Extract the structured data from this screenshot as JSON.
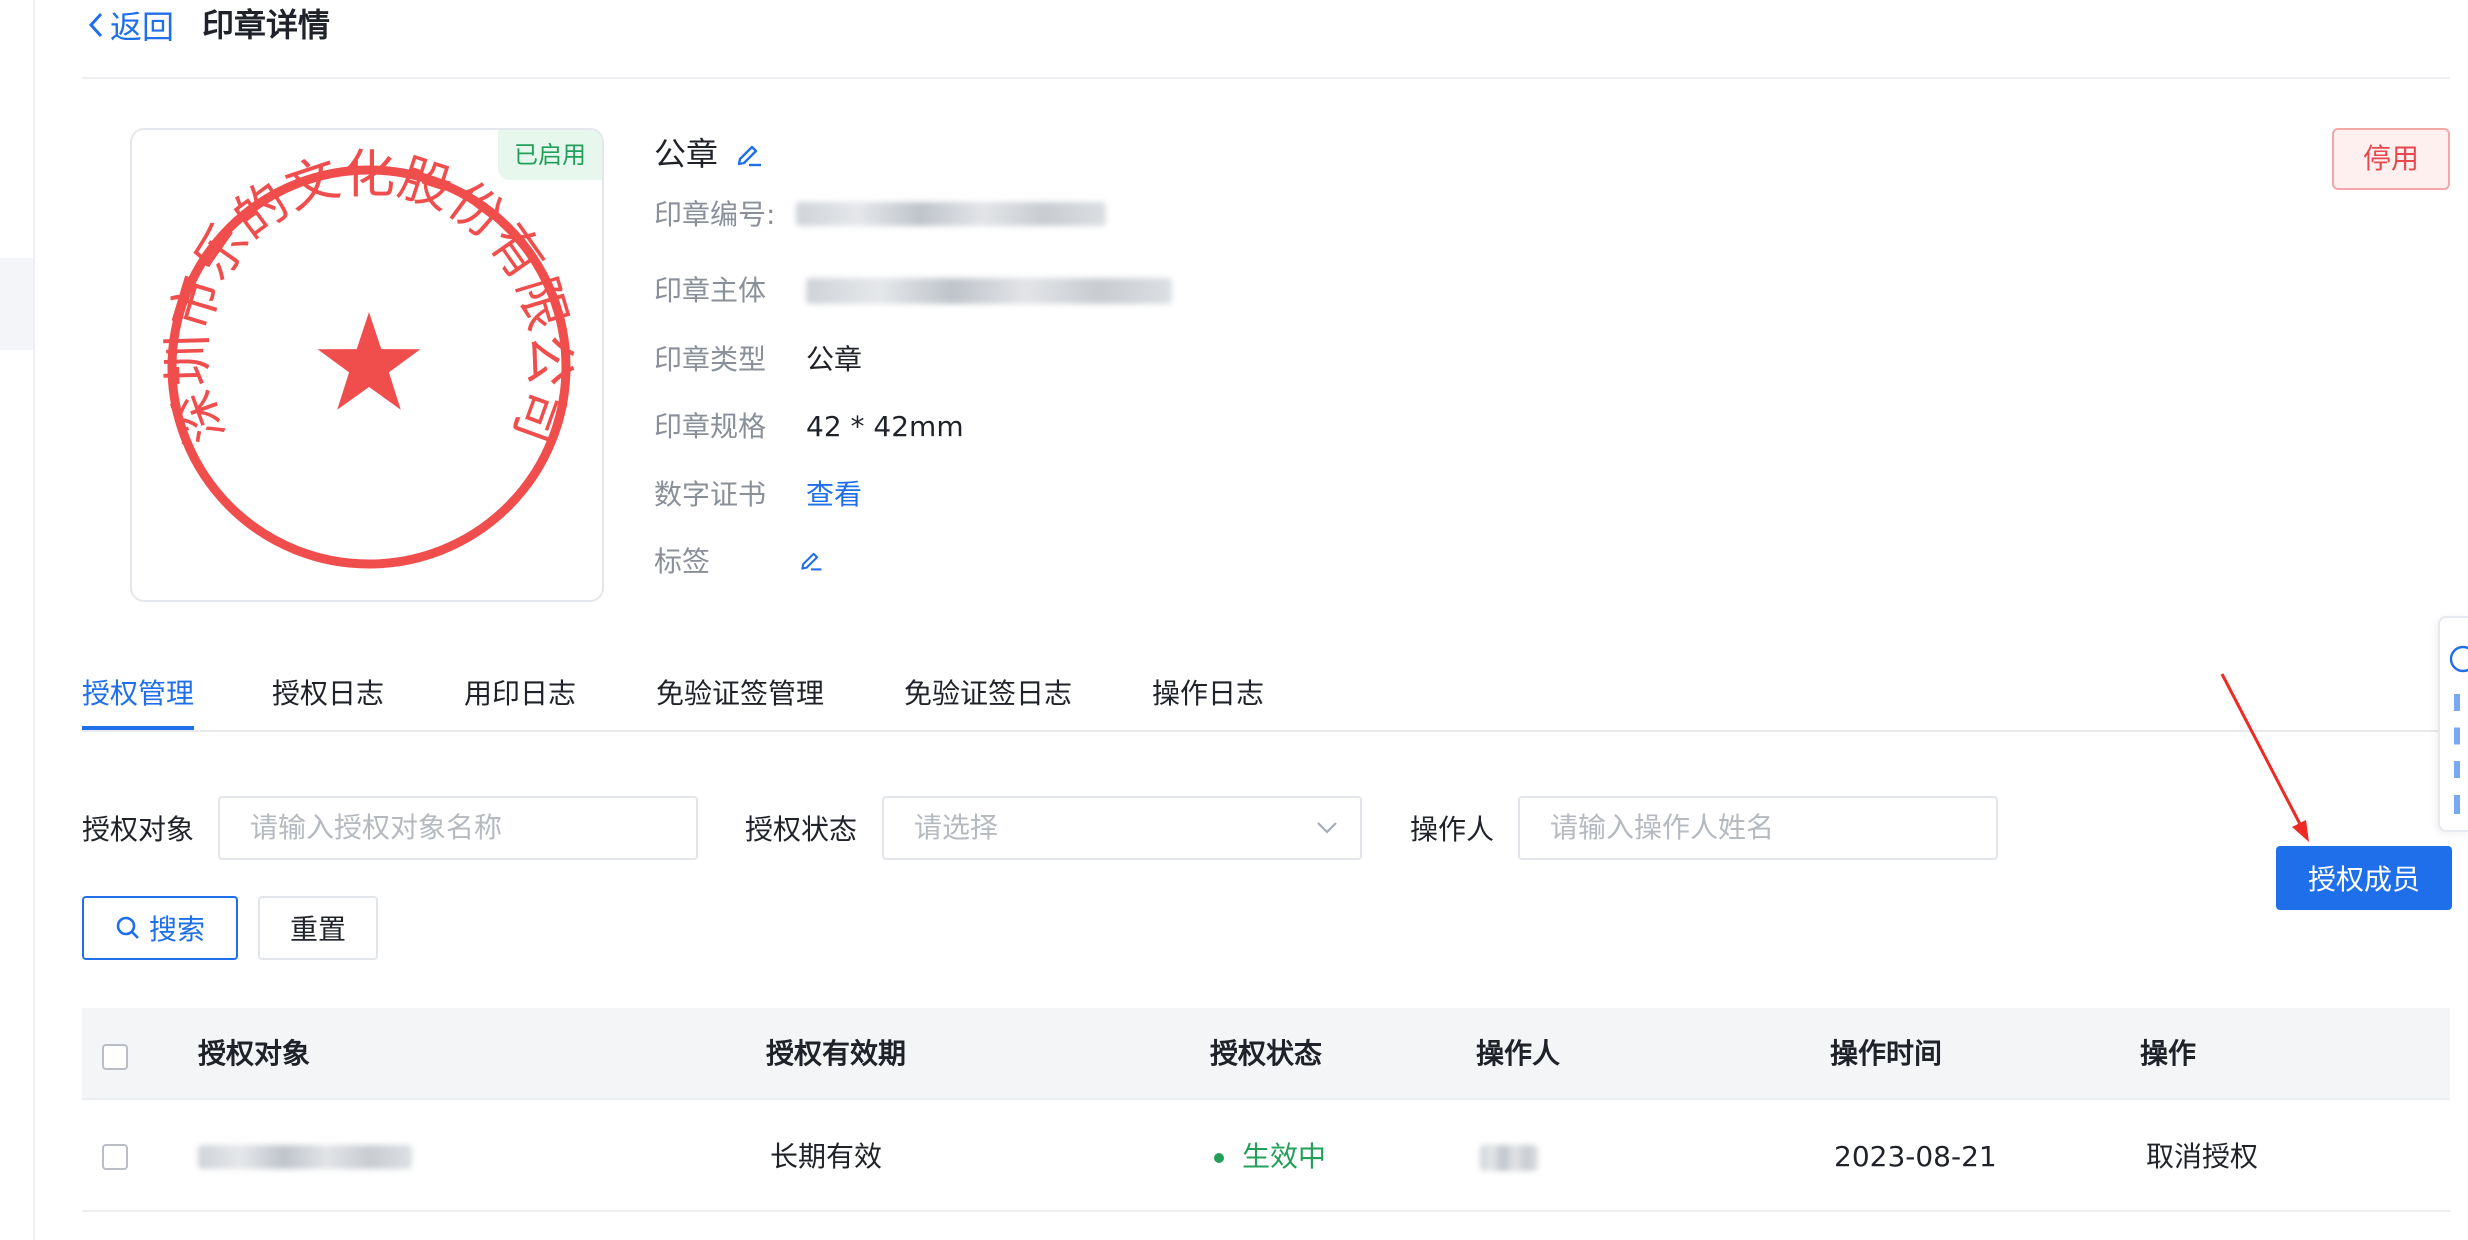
{
  "header": {
    "back_label": "返回",
    "title": "印章详情"
  },
  "seal": {
    "status": "已启用",
    "image_text": "深圳市乐的文化股份有限公司",
    "name": "公章",
    "stop_button": "停用",
    "fields": {
      "number_label": "印章编号:",
      "entity_label": "印章主体",
      "type_label": "印章类型",
      "type_value": "公章",
      "spec_label": "印章规格",
      "spec_value": "42 * 42mm",
      "cert_label": "数字证书",
      "cert_link": "查看",
      "tag_label": "标签"
    }
  },
  "tabs": [
    {
      "label": "授权管理",
      "active": true
    },
    {
      "label": "授权日志",
      "active": false
    },
    {
      "label": "用印日志",
      "active": false
    },
    {
      "label": "免验证签管理",
      "active": false
    },
    {
      "label": "免验证签日志",
      "active": false
    },
    {
      "label": "操作日志",
      "active": false
    }
  ],
  "filters": {
    "target_label": "授权对象",
    "target_placeholder": "请输入授权对象名称",
    "status_label": "授权状态",
    "status_placeholder": "请选择",
    "operator_label": "操作人",
    "operator_placeholder": "请输入操作人姓名",
    "search_button": "搜索",
    "reset_button": "重置",
    "auth_member_button": "授权成员"
  },
  "table": {
    "columns": [
      "授权对象",
      "授权有效期",
      "授权状态",
      "操作人",
      "操作时间",
      "操作"
    ],
    "rows": [
      {
        "validity": "长期有效",
        "status": "生效中",
        "time": "2023-08-21",
        "action": "取消授权"
      }
    ]
  },
  "colors": {
    "primary": "#1f6feb",
    "seal_red": "#f04d4d",
    "success": "#22a05a",
    "danger": "#e5484d"
  }
}
